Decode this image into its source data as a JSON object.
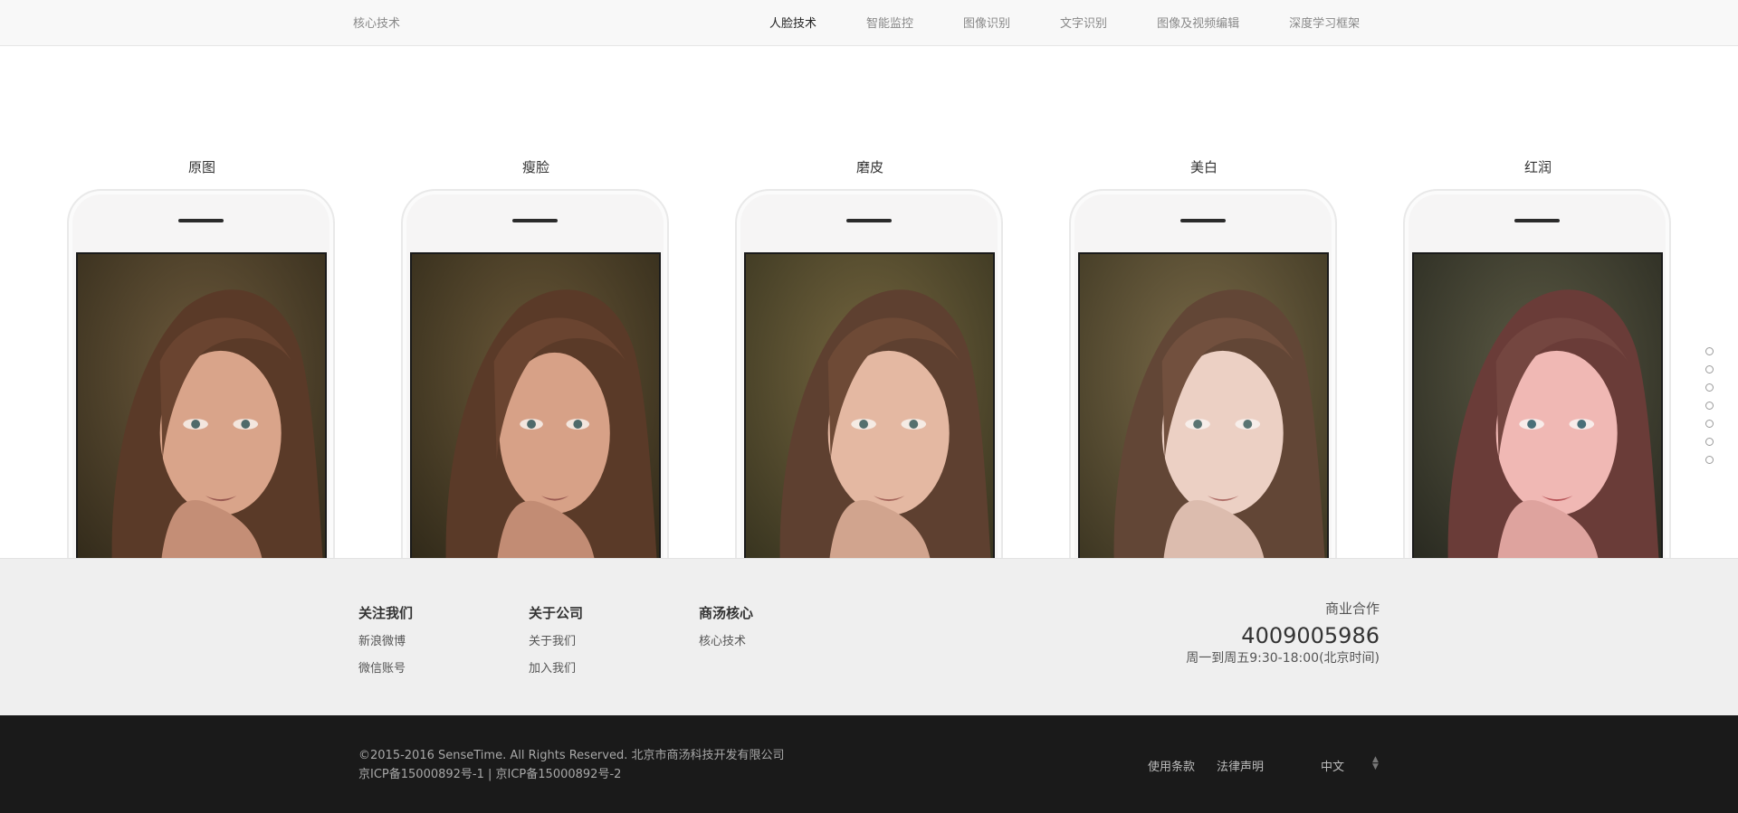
{
  "header": {
    "brand": "核心技术",
    "nav": [
      {
        "label": "人脸技术",
        "active": true
      },
      {
        "label": "智能监控",
        "active": false
      },
      {
        "label": "图像识别",
        "active": false
      },
      {
        "label": "文字识别",
        "active": false
      },
      {
        "label": "图像及视频编辑",
        "active": false
      },
      {
        "label": "深度学习框架",
        "active": false
      }
    ]
  },
  "phones": [
    {
      "label": "原图"
    },
    {
      "label": "瘦脸"
    },
    {
      "label": "磨皮"
    },
    {
      "label": "美白"
    },
    {
      "label": "红润"
    }
  ],
  "section_dots_count": 7,
  "footer": {
    "columns": [
      {
        "title": "关注我们",
        "links": [
          "新浪微博",
          "微信账号"
        ]
      },
      {
        "title": "关于公司",
        "links": [
          "关于我们",
          "加入我们"
        ]
      },
      {
        "title": "商汤核心",
        "links": [
          "核心技术"
        ]
      }
    ],
    "contact": {
      "title": "商业合作",
      "phone": "4009005986",
      "hours": "周一到周五9:30-18:00(北京时间)"
    }
  },
  "bottom": {
    "copyright": "©2015-2016 SenseTime. All Rights Reserved. 北京市商汤科技开发有限公司",
    "icp": "京ICP备15000892号-1 | 京ICP备15000892号-2",
    "terms": "使用条款",
    "legal": "法律声明",
    "language": "中文"
  },
  "colors": {
    "topbar_bg": "#f8f8f8",
    "footer_bg": "#efefef",
    "bottom_bg": "#1a1a1a"
  }
}
